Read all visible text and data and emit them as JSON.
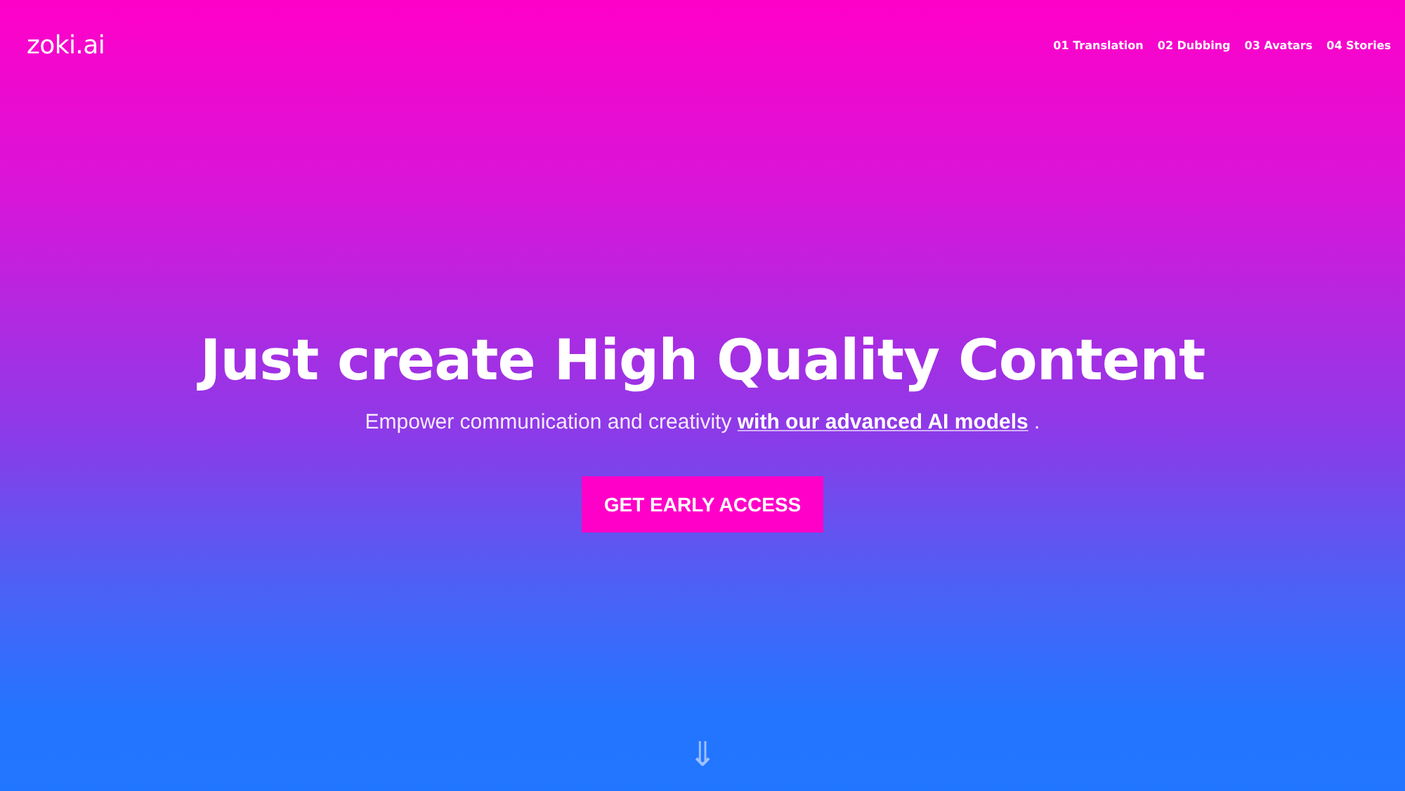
{
  "header": {
    "logo": "zoki.ai",
    "nav": [
      "01 Translation",
      "02 Dubbing",
      "03 Avatars",
      "04 Stories"
    ]
  },
  "hero": {
    "title": "Just create High Quality Content",
    "subtitle": {
      "before": "Empower communication and creativity ",
      "link": "with our advanced AI models",
      "after": " ."
    },
    "button": "GET EARLY ACCESS",
    "scroll_hint": "⇓"
  }
}
